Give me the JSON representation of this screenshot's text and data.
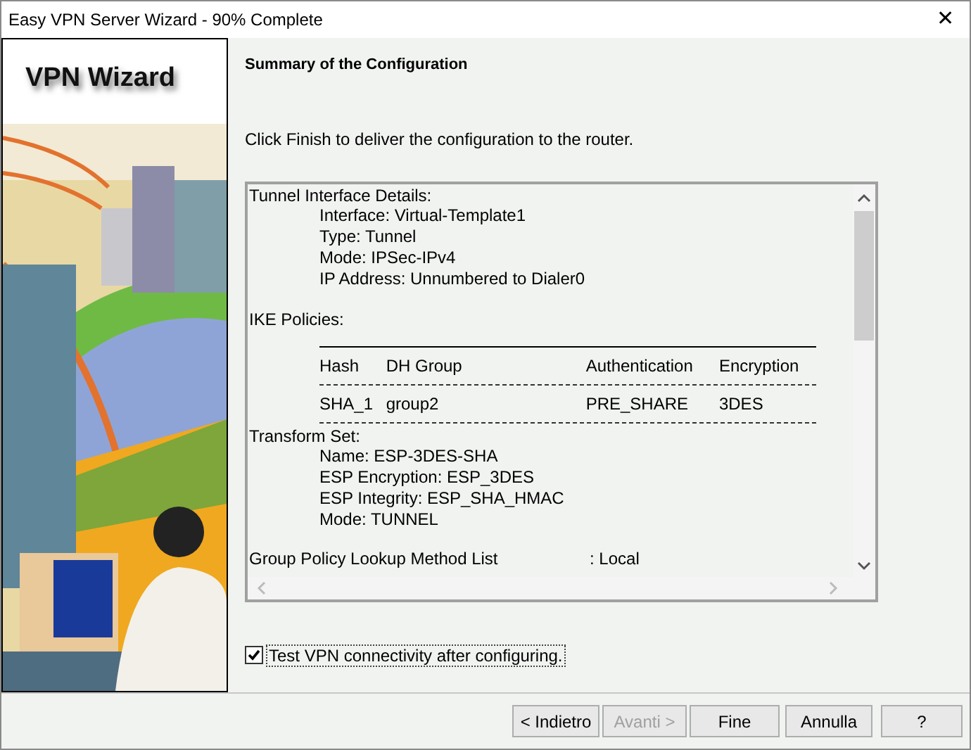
{
  "window": {
    "title": "Easy VPN Server Wizard - 90% Complete",
    "close": "✕"
  },
  "sidebar": {
    "banner": "VPN Wizard"
  },
  "heading": "Summary of the Configuration",
  "instruction": "Click Finish to deliver the configuration to the router.",
  "summary": [
    {
      "kind": "heading",
      "text": "Tunnel Interface Details:"
    },
    {
      "kind": "detail",
      "text": "Interface: Virtual-Template1"
    },
    {
      "kind": "detail",
      "text": "Type: Tunnel"
    },
    {
      "kind": "detail",
      "text": "Mode: IPSec-IPv4"
    },
    {
      "kind": "detail",
      "text": "IP Address: Unnumbered to Dialer0"
    },
    {
      "kind": "heading",
      "text": "IKE Policies:"
    },
    {
      "kind": "table",
      "columns": [
        "Hash",
        "DH Group",
        "Authentication",
        "Encryption"
      ],
      "rows": [
        [
          "SHA_1",
          "group2",
          "PRE_SHARE",
          "3DES"
        ]
      ]
    },
    {
      "kind": "heading",
      "text": "Transform Set:"
    },
    {
      "kind": "detail",
      "text": "Name: ESP-3DES-SHA"
    },
    {
      "kind": "detail",
      "text": "ESP Encryption: ESP_3DES"
    },
    {
      "kind": "detail",
      "text": "ESP Integrity: ESP_SHA_HMAC"
    },
    {
      "kind": "detail",
      "text": "Mode: TUNNEL"
    },
    {
      "kind": "pair",
      "text": "Group Policy Lookup Method List",
      "value": ": Local"
    }
  ],
  "test_checkbox": {
    "label": "Test VPN connectivity after configuring.",
    "checked": true
  },
  "buttons": [
    {
      "label": "< Indietro",
      "disabled": false
    },
    {
      "label": "Avanti >",
      "disabled": true
    },
    {
      "label": "Fine",
      "disabled": false
    },
    {
      "label": "Annulla",
      "disabled": false
    },
    {
      "label": "?",
      "disabled": false
    }
  ]
}
